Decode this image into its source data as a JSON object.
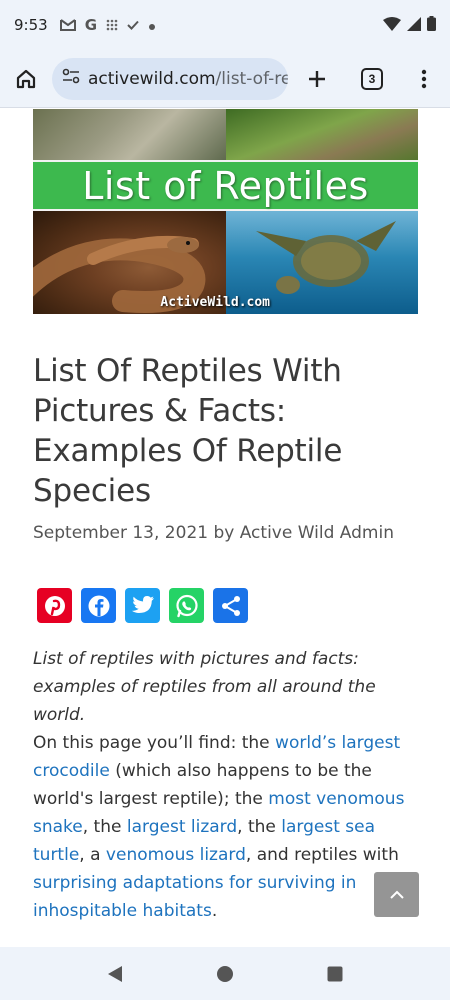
{
  "status_bar": {
    "time": "9:53",
    "left_icons": [
      "gmail-icon",
      "google-icon",
      "grid-icon",
      "check-icon",
      "dot-icon"
    ],
    "right_icons": [
      "wifi-icon",
      "signal-icon",
      "battery-icon"
    ]
  },
  "toolbar": {
    "url_main": "activewild.com",
    "url_path": "/list-of-re",
    "tab_count": "3"
  },
  "hero": {
    "title": "List of Reptiles",
    "watermark": "ActiveWild.com"
  },
  "article": {
    "title": "List Of Reptiles With Pictures & Facts: Examples Of Reptile Species",
    "meta": "September 13, 2021 by Active Wild Admin",
    "intro": "List of reptiles with pictures and facts: examples of reptiles from all around the world.",
    "para": {
      "t1": "On this page you’ll find: the ",
      "l1": "world’s largest crocodile",
      "t2": " (which also happens to be the world's largest reptile); the ",
      "l2": "most venomous snake",
      "t3": ", the ",
      "l3": "largest lizard",
      "t4": ", the ",
      "l4": "largest sea turtle",
      "t5": ", a ",
      "l5": "venomous lizard",
      "t6": ", and reptiles with ",
      "l6": "surprising adaptations for surviving in inhospitable habitats",
      "t7": "."
    }
  },
  "share_buttons": [
    "pinterest-icon",
    "facebook-icon",
    "twitter-icon",
    "whatsapp-icon",
    "share-icon"
  ],
  "colors": {
    "link": "#1e73be",
    "hero_band": "#3db94e",
    "chrome_bg": "#eef3fa"
  }
}
